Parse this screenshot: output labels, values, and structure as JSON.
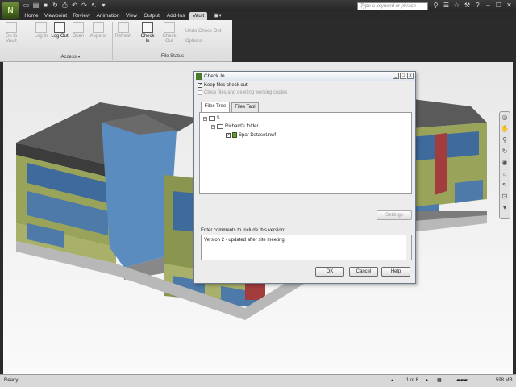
{
  "quick_access": {
    "search_placeholder": "Type a keyword or phrase"
  },
  "tabs": [
    "Home",
    "Viewpoint",
    "Review",
    "Animation",
    "View",
    "Output",
    "Add-Ins",
    "Vault"
  ],
  "active_tab": "Vault",
  "ribbon": {
    "access": {
      "label": "Access",
      "buttons": [
        "Go to Vault",
        "Log In",
        "Log Out",
        "Open",
        "Append"
      ]
    },
    "file_status": {
      "label": "File Status",
      "buttons": [
        "Refresh",
        "Check In",
        "Check Out"
      ],
      "small": [
        "Undo Check Out",
        "Options"
      ]
    }
  },
  "dialog": {
    "title": "Check In",
    "keep_checked_out": "Keep files check out",
    "close_files": "Close files and deleting working copies",
    "tabs": [
      "Files Tree",
      "Files Tabl"
    ],
    "tree": {
      "root": "$",
      "folder": "Richard's folder",
      "file": "Spar Dataset.nwf"
    },
    "settings_button": "Settings",
    "comment_label": "Enter comments to include this version:",
    "comment_value": "Version 2 - updated after site meeting",
    "ok_button": "OK",
    "cancel_button": "Cancel",
    "help_button": "Help"
  },
  "status": {
    "left": "Ready",
    "page": "1 of 6",
    "memory": "598 MB"
  },
  "colors": {
    "accent": "#4a7a2a",
    "ribbon_dark": "#2b2b2b"
  }
}
